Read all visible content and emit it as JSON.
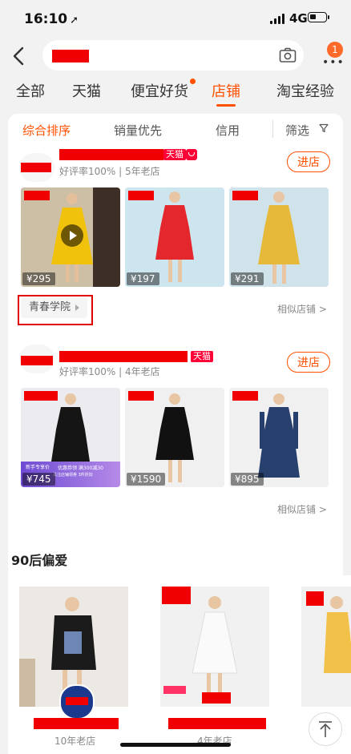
{
  "status_bar": {
    "time": "16:10",
    "network": "4G"
  },
  "nav": {
    "more_badge": "1"
  },
  "tabs": [
    {
      "label": "全部"
    },
    {
      "label": "天猫"
    },
    {
      "label": "便宜好货"
    },
    {
      "label": "店铺"
    },
    {
      "label": "淘宝经验"
    }
  ],
  "sort": {
    "comprehensive": "综合排序",
    "sales": "销量优先",
    "credit": "信用",
    "filter": "筛选"
  },
  "shops": [
    {
      "tmall_label": "天猫",
      "meta": "好评率100% | 5年老店",
      "enter_label": "进店",
      "products": [
        {
          "price": "¥295"
        },
        {
          "price": "¥197"
        },
        {
          "price": "¥291"
        }
      ],
      "tag_label": "青春学院",
      "similar_label": "相似店铺 >"
    },
    {
      "tmall_label": "天猫",
      "meta": "好评率100% | 4年老店",
      "enter_label": "进店",
      "products": [
        {
          "price": "¥745"
        },
        {
          "price": "¥1590"
        },
        {
          "price": "¥895"
        }
      ],
      "promo_top": "新手专享价",
      "promo_mid": "优惠券领 满300减30",
      "promo_bot": "关注店铺领券 3件折扣",
      "similar_label": "相似店铺 >"
    }
  ],
  "section": {
    "title": "90后偏爱"
  },
  "recommend": [
    {
      "meta": "10年老店"
    },
    {
      "meta": "4年老店"
    },
    {
      "meta": ""
    }
  ]
}
